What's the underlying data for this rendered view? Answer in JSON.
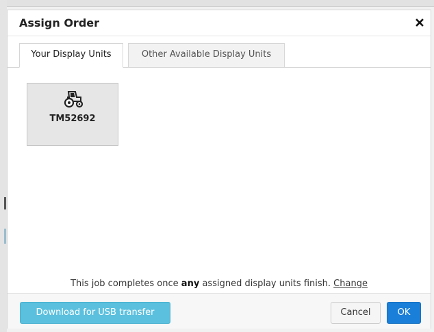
{
  "dialog": {
    "title": "Assign Order",
    "close_icon": "close-icon"
  },
  "tabs": [
    {
      "label": "Your Display Units",
      "active": true
    },
    {
      "label": "Other Available Display Units",
      "active": false
    }
  ],
  "display_units": [
    {
      "icon": "tractor-icon",
      "label": "TM52692"
    }
  ],
  "completion": {
    "prefix": "This job completes once",
    "emphasis": "any",
    "suffix": "assigned display units finish.",
    "link": "Change"
  },
  "footer": {
    "download_label": "Download for USB transfer",
    "cancel_label": "Cancel",
    "ok_label": "OK"
  },
  "colors": {
    "download_button": "#5bc0de",
    "ok_button": "#1a7fd8"
  }
}
